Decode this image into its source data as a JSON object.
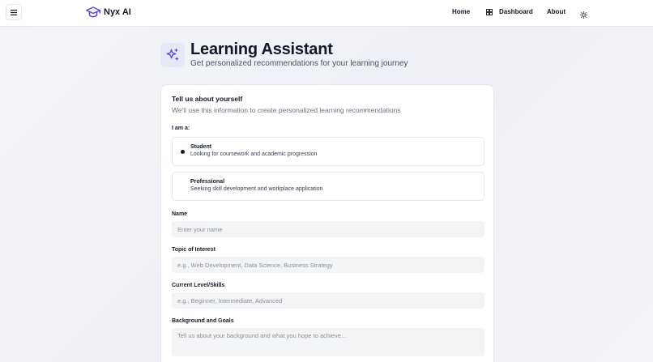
{
  "header": {
    "brand": "Nyx AI",
    "nav": {
      "home": "Home",
      "dashboard": "Dashboard",
      "about": "About"
    },
    "icons": {
      "menu": "menu-icon",
      "logo": "graduation-cap-icon",
      "dashboard": "grid-icon",
      "theme": "sun-icon"
    }
  },
  "hero": {
    "icon": "sparkles-icon",
    "title": "Learning Assistant",
    "subtitle": "Get personalized recommendations for your learning journey"
  },
  "form": {
    "title": "Tell us about yourself",
    "description": "We'll use this information to create personalized learning recommendations",
    "role_label": "I am a:",
    "roles": [
      {
        "title": "Student",
        "description": "Looking for coursework and academic progression",
        "selected": true
      },
      {
        "title": "Professional",
        "description": "Seeking skill development and workplace application",
        "selected": false
      }
    ],
    "name": {
      "label": "Name",
      "placeholder": "Enter your name"
    },
    "topic": {
      "label": "Topic of Interest",
      "placeholder": "e.g., Web Development, Data Science, Business Strategy"
    },
    "level": {
      "label": "Current Level/Skills",
      "placeholder": "e.g., Beginner, Intermediate, Advanced"
    },
    "background": {
      "label": "Background and Goals",
      "placeholder": "Tell us about your background and what you hope to achieve..."
    }
  },
  "colors": {
    "brand_accent": "#4f46e5",
    "text_primary": "#111827",
    "text_muted": "#6b7280",
    "input_bg": "#f3f4f6"
  }
}
